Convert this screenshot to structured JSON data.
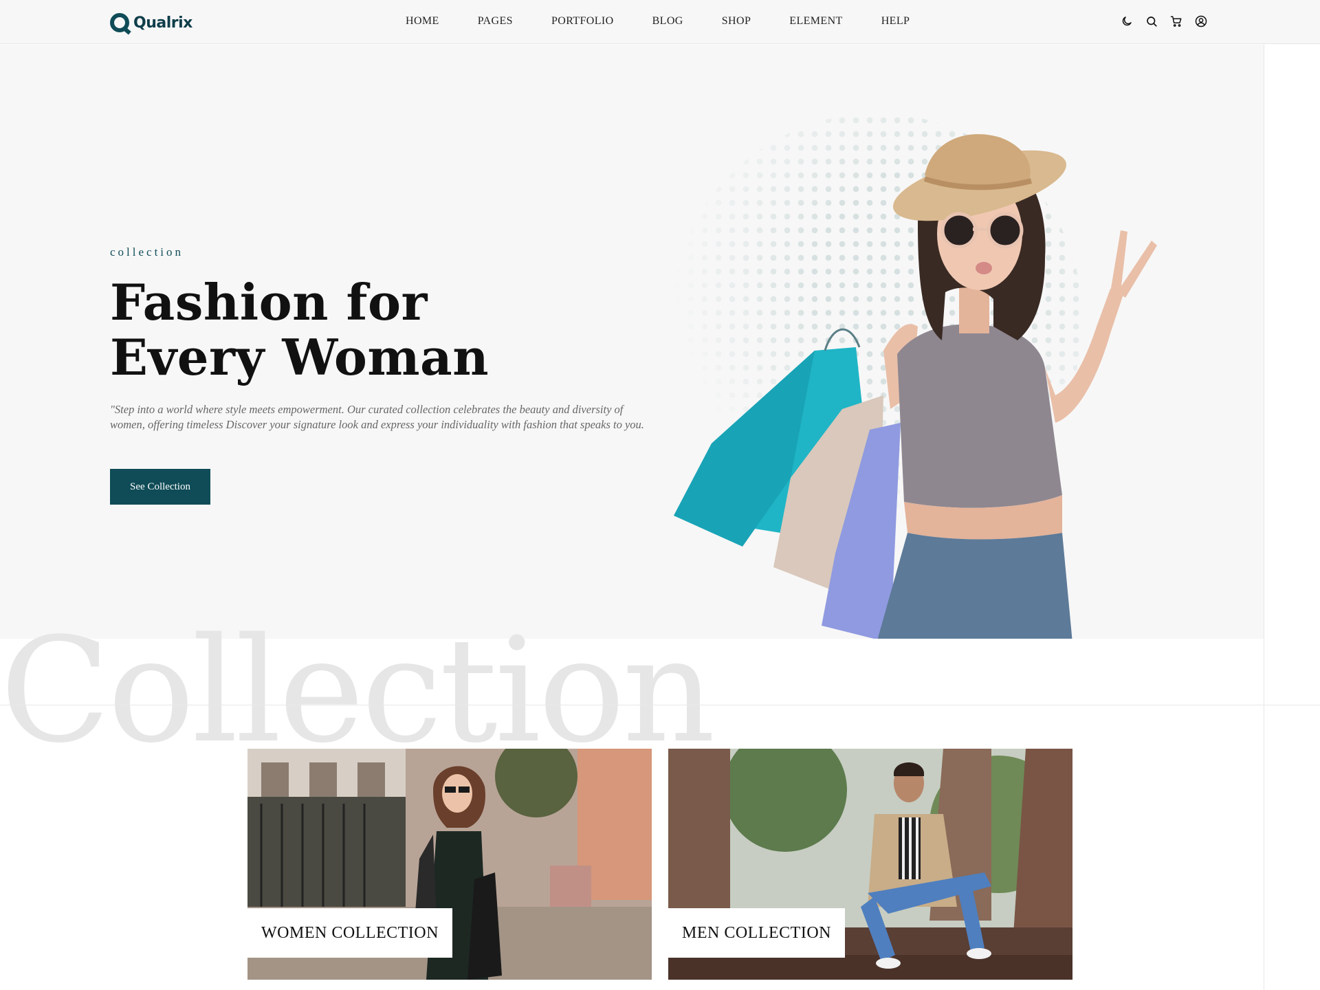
{
  "brand": {
    "name": "Qualrix",
    "accent": "#0f4c57"
  },
  "nav": {
    "items": [
      "HOME",
      "PAGES",
      "PORTFOLIO",
      "BLOG",
      "SHOP",
      "ELEMENT",
      "HELP"
    ]
  },
  "header_icons": [
    "moon-icon",
    "search-icon",
    "cart-icon",
    "user-icon"
  ],
  "hero": {
    "eyebrow": "collection",
    "title": "Fashion for Every Woman",
    "description": "\"Step into a world where style meets empowerment. Our curated collection celebrates the beauty and diversity of women, offering timeless Discover your signature look and express your individuality with fashion that speaks to you.",
    "cta_label": "See Collection"
  },
  "collection": {
    "background_word": "Collection",
    "cards": [
      {
        "label": "WOMEN COLLECTION"
      },
      {
        "label": "MEN COLLECTION"
      }
    ]
  }
}
